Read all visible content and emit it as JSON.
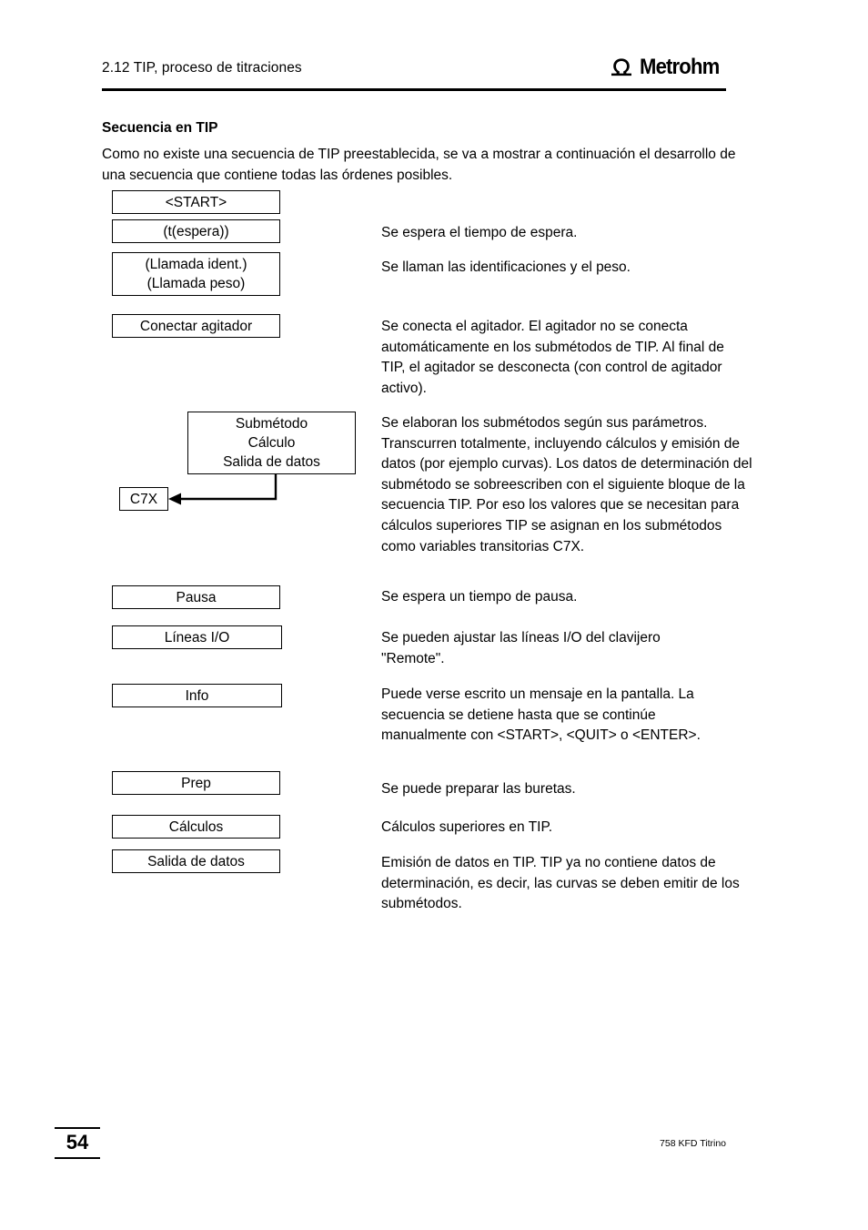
{
  "header": {
    "title": "2.12 TIP, proceso de titraciones",
    "brand": "Metrohm",
    "brand_mark": "metrohm-omega-logo"
  },
  "section": {
    "title": "Secuencia en TIP",
    "intro": "Como no existe una secuencia de TIP preestablecida, se va a mostrar a continuación el desarrollo de una secuencia que contiene todas las órdenes posibles."
  },
  "flowchart": {
    "boxes": [
      {
        "id": "start",
        "lines": [
          "<START>"
        ]
      },
      {
        "id": "espera",
        "lines": [
          "(t(espera))"
        ]
      },
      {
        "id": "llamada",
        "lines": [
          "(Llamada ident.)",
          "(Llamada peso)"
        ]
      },
      {
        "id": "conectar-agitador",
        "lines": [
          "Conectar agitador"
        ]
      },
      {
        "id": "submetodo",
        "lines": [
          "Submétodo",
          "Cálculo",
          "Salida de datos"
        ]
      },
      {
        "id": "c7x",
        "lines": [
          "C7X"
        ]
      },
      {
        "id": "pausa",
        "lines": [
          "Pausa"
        ]
      },
      {
        "id": "lineas-io",
        "lines": [
          "Líneas I/O"
        ]
      },
      {
        "id": "info",
        "lines": [
          "Info"
        ]
      },
      {
        "id": "prep",
        "lines": [
          "Prep"
        ]
      },
      {
        "id": "calculos",
        "lines": [
          "Cálculos"
        ]
      },
      {
        "id": "salida-de-datos",
        "lines": [
          "Salida de datos"
        ]
      }
    ]
  },
  "descriptions": [
    {
      "id": "espera",
      "text": "Se espera el tiempo de espera."
    },
    {
      "id": "llamada",
      "text": "Se llaman las identificaciones y el peso."
    },
    {
      "id": "conectar-agitador",
      "text": "Se conecta el agitador. El agitador no se conecta automáticamente en los submétodos de TIP. Al final de TIP, el agitador se desconecta (con control de agitador activo)."
    },
    {
      "id": "submetodo",
      "text": "Se elaboran los submétodos según sus parámetros. Transcurren totalmente, incluyendo cálculos y emisión de datos (por ejemplo curvas). Los datos de determinación del submétodo se sobreescriben con el siguiente bloque de la secuencia TIP. Por eso los valores que se necesitan para cálculos superiores TIP se asignan en los submétodos como variables transitorias C7X."
    },
    {
      "id": "pausa",
      "text": "Se espera un tiempo de pausa."
    },
    {
      "id": "lineas-io",
      "text": "Se pueden ajustar las líneas I/O del clavijero \"Remote\"."
    },
    {
      "id": "info",
      "text": "Puede verse escrito un mensaje en la pantalla. La secuencia se detiene hasta que se continúe manualmente con <START>, <QUIT> o <ENTER>."
    },
    {
      "id": "prep",
      "text": "Se puede preparar las buretas."
    },
    {
      "id": "calculos",
      "text": "Cálculos superiores en TIP."
    },
    {
      "id": "salida-de-datos",
      "text": "Emisión de datos en TIP. TIP ya no contiene datos de determinación, es decir, las curvas se deben emitir de los submétodos."
    }
  ],
  "footer": {
    "page_number": "54",
    "document_name": "758 KFD Titrino"
  },
  "colors": {
    "ink": "#000000",
    "paper": "#ffffff"
  }
}
